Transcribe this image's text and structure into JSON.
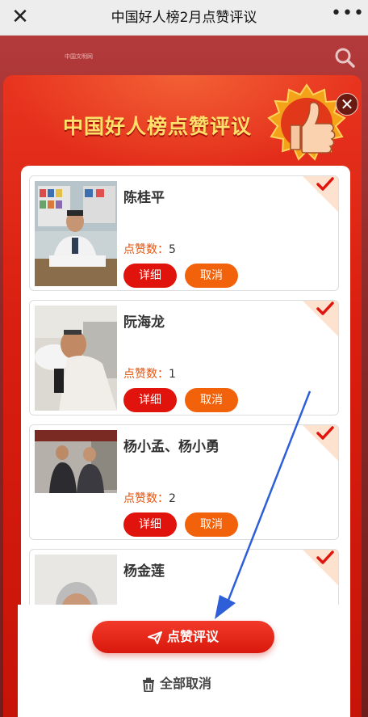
{
  "nav": {
    "close_icon": "close-icon",
    "title": "中国好人榜2月点赞评议",
    "more_icon": "more-dots-icon"
  },
  "background": {
    "site_logo_text": "中国文明网",
    "search_icon": "search-icon"
  },
  "modal": {
    "title": "中国好人榜点赞评议",
    "badge_icon": "thumbs-up-icon",
    "close_icon": "close-icon",
    "likes_label": "点赞数：",
    "detail_label": "详细",
    "cancel_label": "取消",
    "candidates": [
      {
        "name": "陈桂平",
        "likes": "5",
        "selected": true
      },
      {
        "name": "阮海龙",
        "likes": "1",
        "selected": true
      },
      {
        "name": "杨小孟、杨小勇",
        "likes": "2",
        "selected": true
      },
      {
        "name": "杨金莲",
        "likes": "",
        "selected": true
      }
    ],
    "vote_button": "点赞评议",
    "clear_all": "全部取消"
  },
  "colors": {
    "accent_red": "#e0140c",
    "cancel_orange": "#f2620a",
    "title_yellow": "#ffe06a"
  }
}
